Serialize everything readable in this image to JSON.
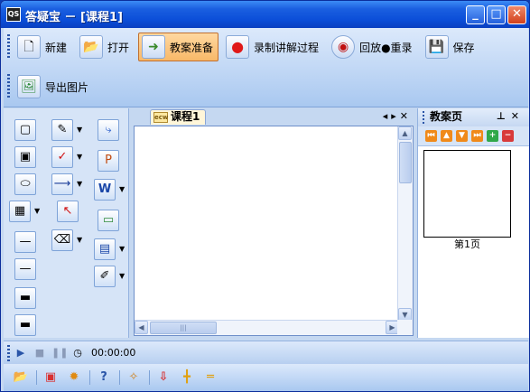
{
  "window": {
    "title": "答疑宝 － [课程1]",
    "icon_text": "QS",
    "controls": [
      "minimize",
      "maximize",
      "close"
    ]
  },
  "toolbar": {
    "row1": [
      {
        "label": "新建",
        "icon": "new-document-icon"
      },
      {
        "label": "打开",
        "icon": "open-folder-icon"
      },
      {
        "label": "教案准备",
        "icon": "lesson-prep-icon",
        "active": true
      },
      {
        "label": "录制讲解过程",
        "icon": "record-icon"
      },
      {
        "label": "回放●重录",
        "icon": "playback-icon"
      },
      {
        "label": "保存",
        "icon": "save-icon"
      }
    ],
    "row2": [
      {
        "label": "导出图片",
        "icon": "export-image-icon"
      }
    ]
  },
  "document": {
    "tab_label": "课程1",
    "tab_icon_text": "ecw"
  },
  "page_panel": {
    "title": "教案页",
    "thumbnail_label": "第1页"
  },
  "status": {
    "time": "00:00:00"
  },
  "colors": {
    "titlebar": "#0b4ed8",
    "active_button": "#f8b868",
    "panel_bg": "#d6e4f7",
    "canvas": "#ffffff"
  }
}
